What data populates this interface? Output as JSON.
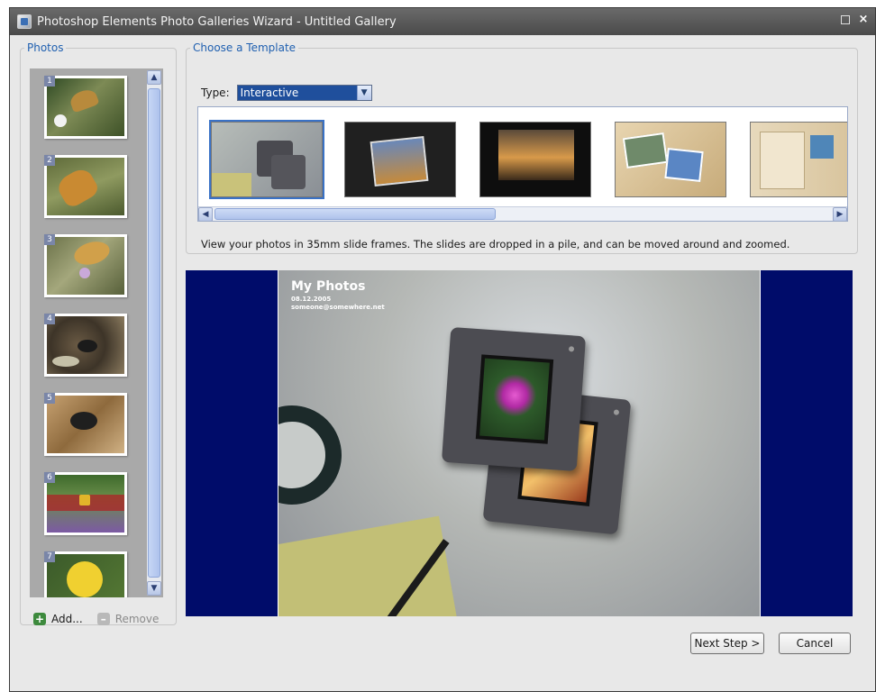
{
  "window": {
    "title": "Photoshop Elements Photo Galleries Wizard - Untitled Gallery",
    "close_glyph": "×"
  },
  "photos_panel": {
    "legend": "Photos",
    "photos": [
      {
        "number": "1"
      },
      {
        "number": "2"
      },
      {
        "number": "3"
      },
      {
        "number": "4"
      },
      {
        "number": "5"
      },
      {
        "number": "6"
      },
      {
        "number": "7"
      }
    ],
    "add_label": "Add...",
    "remove_label": "Remove"
  },
  "template_panel": {
    "legend": "Choose a Template",
    "type_label": "Type:",
    "type_value": "Interactive",
    "description": "View your photos in 35mm slide frames. The slides are dropped in a pile, and can be moved around and zoomed."
  },
  "preview": {
    "title": "My Photos",
    "date": "08.12.2005",
    "email": "someone@somewhere.net"
  },
  "buttons": {
    "next": "Next Step >",
    "cancel": "Cancel"
  },
  "colors": {
    "accent": "#2060b0",
    "preview_background": "#000c6a",
    "selection": "#1f4f9c"
  }
}
